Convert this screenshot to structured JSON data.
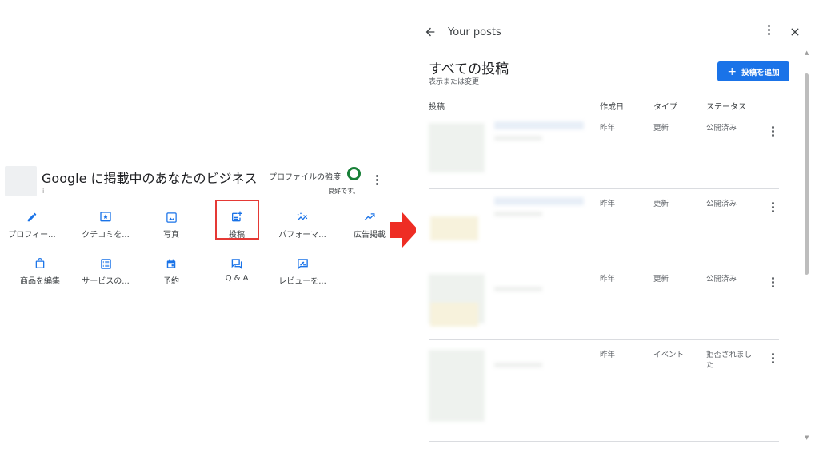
{
  "business": {
    "title": "Google に掲載中のあなたのビジネス",
    "subtitle": "i",
    "strength_label": "プロファイルの強度",
    "strength_status": "良好です。",
    "strength_color": "#188038",
    "actions": [
      {
        "label": "プロフィー...",
        "icon": "edit-icon"
      },
      {
        "label": "クチコミを...",
        "icon": "review-star-icon"
      },
      {
        "label": "写真",
        "icon": "photo-icon"
      },
      {
        "label": "投稿",
        "icon": "post-add-icon"
      },
      {
        "label": "パフォーマ...",
        "icon": "performance-icon"
      },
      {
        "label": "広告掲載",
        "icon": "trending-up-icon"
      },
      {
        "label": "商品を編集",
        "icon": "shopping-bag-icon"
      },
      {
        "label": "サービスの...",
        "icon": "list-icon"
      },
      {
        "label": "予約",
        "icon": "calendar-icon"
      },
      {
        "label": "Q & A",
        "icon": "qa-icon"
      },
      {
        "label": "レビューを...",
        "icon": "rate-review-icon"
      }
    ]
  },
  "highlight_color": "#e53935",
  "posts_panel": {
    "title": "Your posts",
    "section_title": "すべての投稿",
    "section_subtitle": "表示または変更",
    "add_button": "投稿を追加",
    "accent_color": "#1a73e8",
    "columns": [
      "投稿",
      "作成日",
      "タイプ",
      "ステータス"
    ],
    "rows": [
      {
        "date": "昨年",
        "type": "更新",
        "status": "公開済み"
      },
      {
        "date": "昨年",
        "type": "更新",
        "status": "公開済み"
      },
      {
        "date": "昨年",
        "type": "更新",
        "status": "公開済み"
      },
      {
        "date": "昨年",
        "type": "イベント",
        "status": "拒否されました"
      }
    ]
  }
}
